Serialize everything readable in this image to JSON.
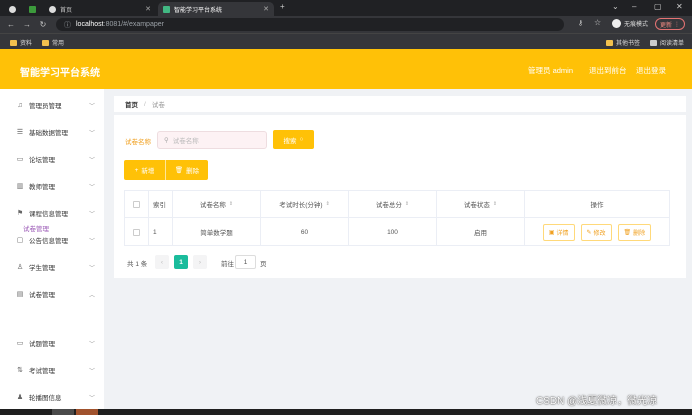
{
  "browser": {
    "tabs": [
      {
        "label": ""
      },
      {
        "label": "首页"
      },
      {
        "label": "智能学习平台系统"
      }
    ],
    "url_host": "localhost",
    "url_path": ":8081/#/exampaper",
    "incognito_label": "无痕模式",
    "update_label": "更新",
    "bookmarks": [
      "资料",
      "常用"
    ],
    "bookmarks_right": [
      "其他书签",
      "阅读清单"
    ]
  },
  "header": {
    "title": "智能学习平台系统",
    "user_label": "管理员 admin",
    "front_link": "退出到前台",
    "logout_link": "退出登录"
  },
  "sidebar": {
    "items": [
      {
        "label": "管理员管理",
        "icon": "mic-icon",
        "glyph": "♫",
        "expanded": false
      },
      {
        "label": "基础数据管理",
        "icon": "list-icon",
        "glyph": "☰",
        "expanded": false
      },
      {
        "label": "论坛管理",
        "icon": "monitor-icon",
        "glyph": "▭",
        "expanded": false
      },
      {
        "label": "教师管理",
        "icon": "bar-chart-icon",
        "glyph": "▥",
        "expanded": false
      },
      {
        "label": "课程信息管理",
        "icon": "flag-icon",
        "glyph": "⚑",
        "expanded": false
      },
      {
        "label": "公告信息管理",
        "icon": "message-icon",
        "glyph": "▢",
        "expanded": false
      },
      {
        "label": "学生管理",
        "icon": "user-icon",
        "glyph": "♙",
        "expanded": false
      },
      {
        "label": "试卷管理",
        "icon": "document-icon",
        "glyph": "▤",
        "expanded": true
      },
      {
        "label": "试题管理",
        "icon": "monitor-icon",
        "glyph": "▭",
        "expanded": false
      },
      {
        "label": "考试管理",
        "icon": "sort-icon",
        "glyph": "⇅",
        "expanded": false
      },
      {
        "label": "轮播图信息",
        "icon": "person-icon",
        "glyph": "♟",
        "expanded": false
      }
    ],
    "sub_item": "试卷管理"
  },
  "breadcrumb": {
    "home": "首页",
    "separator": "/",
    "current": "试卷"
  },
  "search": {
    "label": "试卷名称",
    "placeholder": "试卷名称",
    "button": "搜索"
  },
  "actions": {
    "add": "新增",
    "delete": "删除"
  },
  "table": {
    "columns": [
      "索引",
      "试卷名称",
      "考试时长(分钟)",
      "试卷总分",
      "试卷状态",
      "操作"
    ],
    "rows": [
      {
        "index": "1",
        "name": "简单数学题",
        "duration": "60",
        "score": "100",
        "status": "启用"
      }
    ],
    "row_actions": {
      "detail": "详情",
      "edit": "修改",
      "delete": "删除"
    }
  },
  "pagination": {
    "total_prefix": "共",
    "total": "1",
    "total_suffix": "条",
    "current_page": "1",
    "goto_label": "前往",
    "goto_value": "1",
    "goto_suffix": "页"
  },
  "watermark": "CSDN @浅夏微凉，微光凉",
  "colors": {
    "accent": "#ffc107",
    "page_active": "#1abc9c",
    "submenu": "#9b59b6"
  }
}
